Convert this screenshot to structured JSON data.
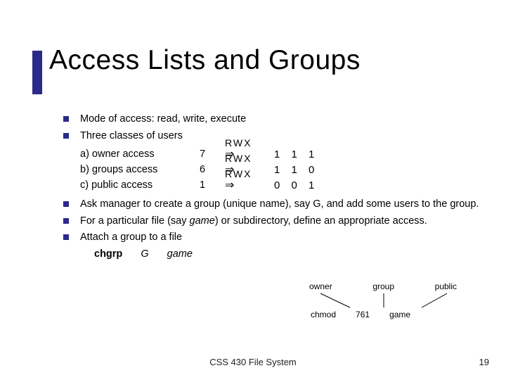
{
  "title": "Access Lists and Groups",
  "bullets": {
    "b1": "Mode of access:  read, write, execute",
    "b2": "Three classes of users",
    "b3_pre": "Ask manager to create a group (unique name), say G, and add some users to the group.",
    "b4_pre": "For a particular file (say ",
    "b4_game": "game",
    "b4_post": ") or subdirectory, define an appropriate access.",
    "b5": "Attach a group to a file"
  },
  "perm": {
    "a_label": "a) owner access",
    "a_num": "7",
    "a_rwx": "RWX",
    "a_bits": "1 1 1",
    "b_label": "b) groups access",
    "b_num": "6",
    "b_rwx": "RWX",
    "b_bits": "1 1 0",
    "c_label": "c) public access",
    "c_num": "1",
    "c_rwx": "RWX",
    "c_bits": "0 0 1",
    "arrow": "⇒"
  },
  "cmd": {
    "chgrp": "chgrp",
    "G": "G",
    "game": "game"
  },
  "diagram": {
    "owner": "owner",
    "group": "group",
    "public": "public",
    "chmod": "chmod",
    "mode": "761",
    "file": "game"
  },
  "footer": {
    "center": "CSS 430 File System",
    "page": "19"
  }
}
